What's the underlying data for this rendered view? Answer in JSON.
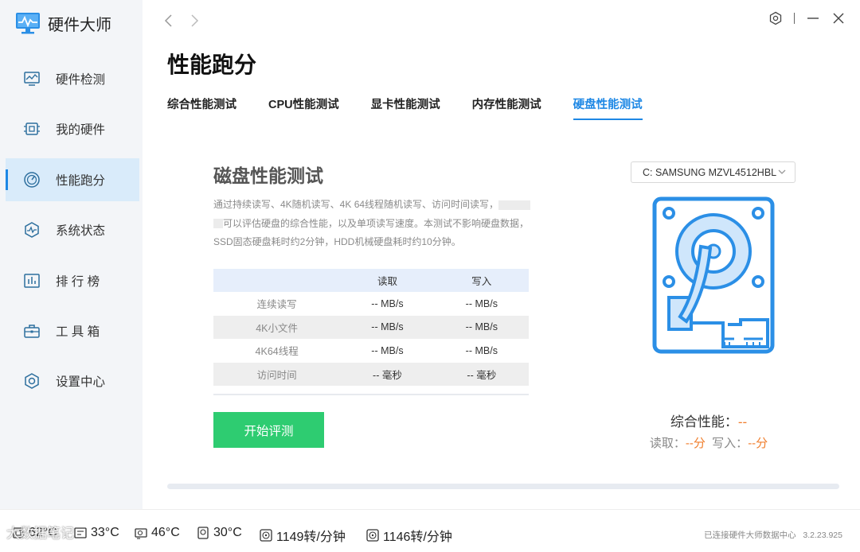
{
  "app": {
    "name": "硬件大师"
  },
  "nav": {
    "items": [
      {
        "label": "硬件检测",
        "icon": "monitor-chart-icon"
      },
      {
        "label": "我的硬件",
        "icon": "chip-icon"
      },
      {
        "label": "性能跑分",
        "icon": "speedometer-icon",
        "active": true
      },
      {
        "label": "系统状态",
        "icon": "heartbeat-icon"
      },
      {
        "label": "排 行 榜",
        "icon": "bar-chart-icon"
      },
      {
        "label": "工 具 箱",
        "icon": "toolbox-icon"
      },
      {
        "label": "设置中心",
        "icon": "settings-icon"
      }
    ]
  },
  "page": {
    "title": "性能跑分"
  },
  "tabs": [
    {
      "label": "综合性能测试"
    },
    {
      "label": "CPU性能测试"
    },
    {
      "label": "显卡性能测试"
    },
    {
      "label": "内存性能测试"
    },
    {
      "label": "硬盘性能测试",
      "active": true
    }
  ],
  "panel": {
    "title": "磁盘性能测试",
    "desc_1": "通过持续读写、4K随机读写、4K 64线程随机读写、访问时间读写，",
    "desc_2": "可以评估硬盘的综合性能，以及单项读写速度。本测试不影响硬盘数据，",
    "desc_3": "SSD固态硬盘耗时约2分钟，HDD机械硬盘耗时约10分钟。"
  },
  "table": {
    "headers": [
      "",
      "读取",
      "写入"
    ],
    "rows": [
      {
        "name": "连续读写",
        "read": "-- MB/s",
        "write": "-- MB/s"
      },
      {
        "name": "4K小文件",
        "read": "-- MB/s",
        "write": "-- MB/s"
      },
      {
        "name": "4K64线程",
        "read": "-- MB/s",
        "write": "-- MB/s"
      },
      {
        "name": "访问时间",
        "read": "-- 毫秒",
        "write": "-- 毫秒"
      }
    ]
  },
  "start_button": "开始评测",
  "drive": {
    "selected": "C: SAMSUNG MZVL4512HBL"
  },
  "score": {
    "main_label": "综合性能：",
    "main_value": "--",
    "read_label": "读取：",
    "read_value": "--分",
    "write_label": "写入：",
    "write_value": "--分"
  },
  "status": {
    "cpu_temp": "62°C",
    "mainboard_temp": "33°C",
    "gpu_temp": "46°C",
    "disk_temp": "30°C",
    "fan1": "1149转/分钟",
    "fan2": "1146转/分钟",
    "connection": "已连接硬件大师数据中心",
    "version": "3.2.23.925"
  },
  "watermark": "大数据笔记",
  "colors": {
    "accent": "#1e88e5",
    "start": "#2ecc71",
    "orange": "#f07d2b"
  }
}
